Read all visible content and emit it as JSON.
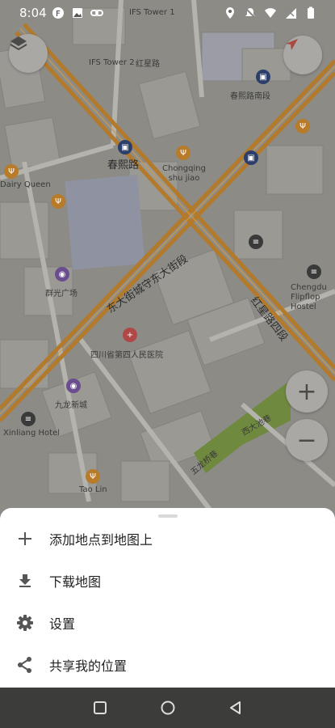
{
  "status_bar": {
    "time": "8:04",
    "left_icons": [
      "app-notification-icon",
      "image-icon",
      "link-icon"
    ],
    "right_icons": [
      "location-icon",
      "mute-icon",
      "wifi-icon",
      "signal-icon",
      "battery-icon"
    ]
  },
  "map": {
    "labels": [
      {
        "text": "春熙路",
        "size": "big"
      },
      {
        "text": "东大街城守东大街段",
        "size": "big"
      },
      {
        "text": "红星路四段",
        "size": "big"
      },
      {
        "text": "Chengdu Flipflop Hostel"
      },
      {
        "text": "Chongqing shu jiao"
      },
      {
        "text": "四川省第四人民医院"
      },
      {
        "text": "群光广场"
      },
      {
        "text": "九龙新城"
      },
      {
        "text": "Xinliang Hotel"
      },
      {
        "text": "Tao Lin"
      },
      {
        "text": "Dairy Queen"
      },
      {
        "text": "IFS Tower 1"
      },
      {
        "text": "IFS Tower 2"
      },
      {
        "text": "红星路"
      },
      {
        "text": "春熙路南段"
      },
      {
        "text": "五龙桥巷"
      },
      {
        "text": "西大池巷"
      }
    ],
    "accent_road_color": "#b27a2a",
    "park_color": "#6f8a3e"
  },
  "controls": {
    "zoom_in_label": "+",
    "zoom_out_label": "−"
  },
  "sheet": {
    "items": [
      {
        "label": "添加地点到地图上",
        "icon": "plus-icon"
      },
      {
        "label": "下载地图",
        "icon": "download-icon"
      },
      {
        "label": "设置",
        "icon": "gear-icon"
      },
      {
        "label": "共享我的位置",
        "icon": "share-icon"
      }
    ]
  },
  "nav_bar": {
    "buttons": [
      "recents-icon",
      "home-icon",
      "back-icon"
    ]
  }
}
